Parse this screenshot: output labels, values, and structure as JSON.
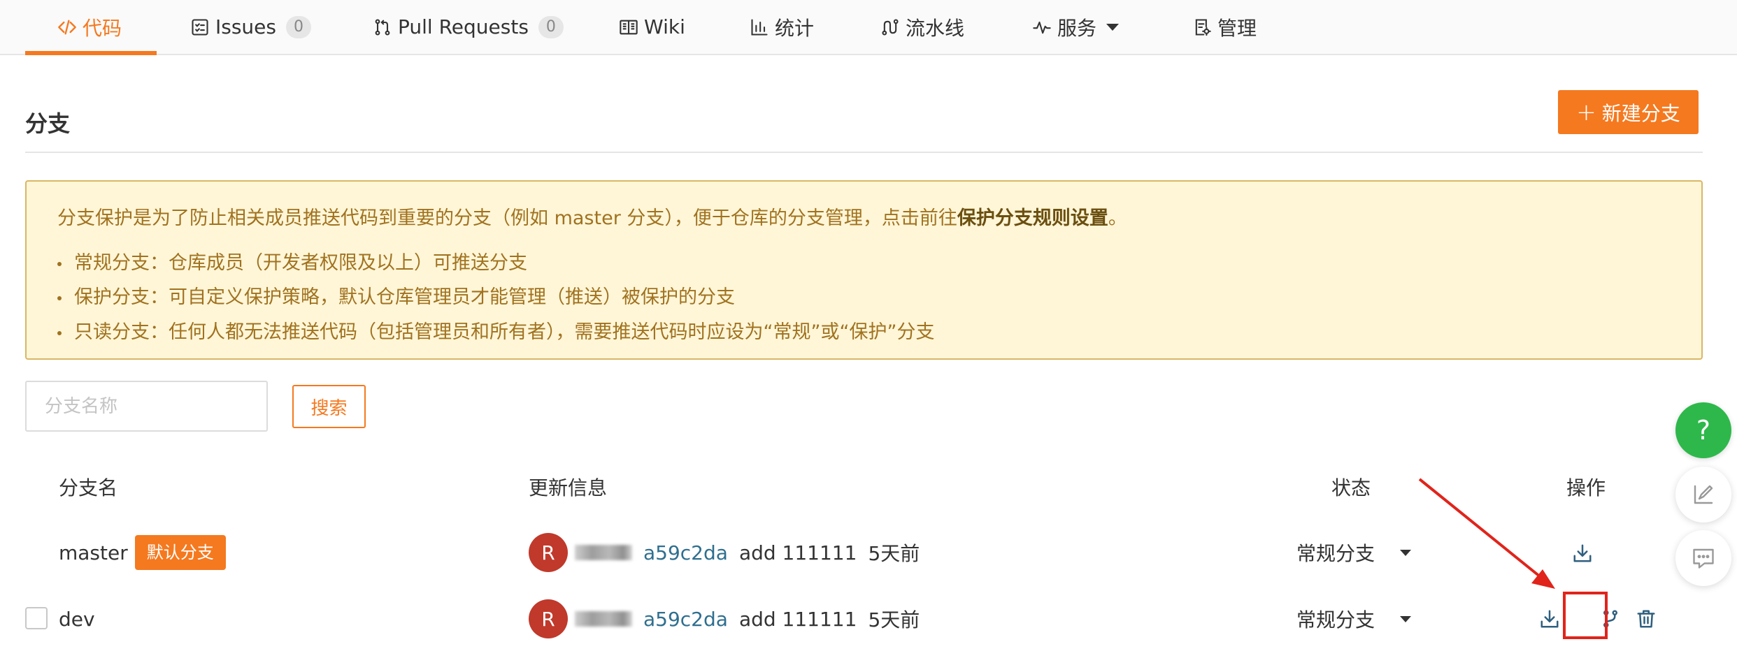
{
  "tabs": [
    {
      "label": "代码",
      "icon": "code-icon",
      "active": true
    },
    {
      "label": "Issues",
      "icon": "issues-icon",
      "count": "0"
    },
    {
      "label": "Pull Requests",
      "icon": "pull-request-icon",
      "count": "0"
    },
    {
      "label": "Wiki",
      "icon": "wiki-book-icon"
    },
    {
      "label": "统计",
      "icon": "bar-chart-icon"
    },
    {
      "label": "流水线",
      "icon": "pipeline-icon"
    },
    {
      "label": "服务",
      "icon": "pulse-icon",
      "dropdown": true
    },
    {
      "label": "管理",
      "icon": "settings-doc-icon"
    }
  ],
  "header": {
    "title": "分支",
    "new_branch_plus": "+",
    "new_branch_label": "新建分支"
  },
  "notice": {
    "intro": "分支保护是为了防止相关成员推送代码到重要的分支（例如 master 分支），便于仓库的分支管理，点击前往",
    "intro_link": "保护分支规则设置",
    "intro_end": "。",
    "bullets": [
      "常规分支：仓库成员（开发者权限及以上）可推送分支",
      "保护分支：可自定义保护策略，默认仓库管理员才能管理（推送）被保护的分支",
      "只读分支：任何人都无法推送代码（包括管理员和所有者），需要推送代码时应设为“常规”或“保护”分支"
    ]
  },
  "search": {
    "placeholder": "分支名称",
    "button_label": "搜索"
  },
  "table": {
    "headers": {
      "name": "分支名",
      "update": "更新信息",
      "status": "状态",
      "actions": "操作"
    },
    "rows": [
      {
        "name": "master",
        "default_badge": "默认分支",
        "avatar_letter": "R",
        "commit_id": "a59c2da",
        "commit_message": "add 111111",
        "time": "5天前",
        "status": "常规分支",
        "actions": [
          "download-icon"
        ]
      },
      {
        "name": "dev",
        "avatar_letter": "R",
        "commit_id": "a59c2da",
        "commit_message": "add 111111",
        "time": "5天前",
        "status": "常规分支",
        "actions": [
          "download-icon",
          "merge-request-icon",
          "trash-icon"
        ]
      }
    ]
  },
  "floating": {
    "help_label": "?"
  },
  "colors": {
    "accent": "#f5791f",
    "notice_bg": "#fff6d8",
    "notice_border": "#d8b766",
    "notice_text": "#a0721f",
    "help_green": "#2eb84b",
    "link_blue": "#2f6f8f",
    "annotation_red": "#e0241b"
  }
}
